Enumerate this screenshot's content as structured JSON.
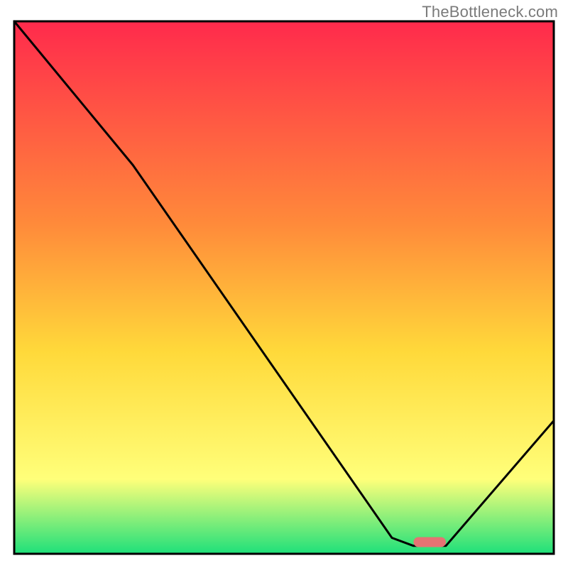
{
  "watermark": "TheBottleneck.com",
  "chart_data": {
    "type": "line",
    "title": "",
    "xlabel": "",
    "ylabel": "",
    "xlim": [
      0,
      100
    ],
    "ylim": [
      0,
      100
    ],
    "grid": false,
    "legend": false,
    "annotations": [],
    "curve": [
      {
        "x": 0,
        "y": 100
      },
      {
        "x": 22,
        "y": 73
      },
      {
        "x": 70,
        "y": 3
      },
      {
        "x": 74,
        "y": 1.5
      },
      {
        "x": 80,
        "y": 1.5
      },
      {
        "x": 100,
        "y": 25
      }
    ],
    "marker": {
      "x_start": 74,
      "x_end": 80,
      "y": 2.2,
      "color": "#e57373"
    },
    "background_gradient": {
      "top": "#ff2a4c",
      "mid_upper": "#ff8a3a",
      "mid": "#ffd93a",
      "mid_lower": "#ffff7a",
      "bottom": "#1ee07a"
    },
    "frame_color": "#000000",
    "line_color": "#000000"
  }
}
